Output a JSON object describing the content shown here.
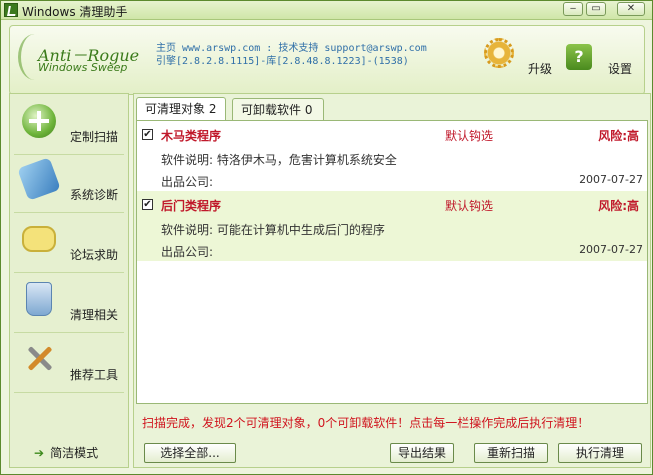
{
  "window": {
    "title": "Windows 清理助手",
    "controls": {
      "minimize": "‒",
      "maximize": "▭",
      "close": "✕"
    }
  },
  "logo": {
    "line1": "Anti－Rogue",
    "line2": "Windows Sweep"
  },
  "header": {
    "info_line1": "主页 www.arswp.com : 技术支持 support@arswp.com",
    "info_line2": "引擎[2.8.2.8.1115]-库[2.8.48.8.1223]-(1538)",
    "upgrade_label": "升级",
    "settings_label": "设置"
  },
  "sidebar": {
    "items": [
      {
        "label": "定制扫描",
        "icon": "plus-icon"
      },
      {
        "label": "系统诊断",
        "icon": "diagnose-icon"
      },
      {
        "label": "论坛求助",
        "icon": "chat-icon"
      },
      {
        "label": "清理相关",
        "icon": "recycle-bin-icon"
      },
      {
        "label": "推荐工具",
        "icon": "tools-icon"
      }
    ],
    "simple_mode": "简洁模式"
  },
  "tabs": [
    {
      "label": "可清理对象 2",
      "active": true
    },
    {
      "label": "可卸载软件 0",
      "active": false
    }
  ],
  "items": [
    {
      "checked": "✔",
      "name": "木马类程序",
      "default": "默认钩选",
      "risk": "风险:高",
      "desc": "软件说明: 特洛伊木马，危害计算机系统安全",
      "company": "出品公司:",
      "date": "2007-07-27"
    },
    {
      "checked": "✔",
      "name": "后门类程序",
      "default": "默认钩选",
      "risk": "风险:高",
      "desc": "软件说明: 可能在计算机中生成后门的程序",
      "company": "出品公司:",
      "date": "2007-07-27"
    }
  ],
  "status": "扫描完成，发现2个可清理对象，0个可卸载软件！点击每一栏操作完成后执行清理！",
  "buttons": {
    "select_all": "选择全部...",
    "export": "导出结果",
    "rescan": "重新扫描",
    "clean": "执行清理"
  },
  "colors": {
    "accent": "#5c8a2e",
    "danger": "#c0182a",
    "link": "#2f6fa8"
  }
}
